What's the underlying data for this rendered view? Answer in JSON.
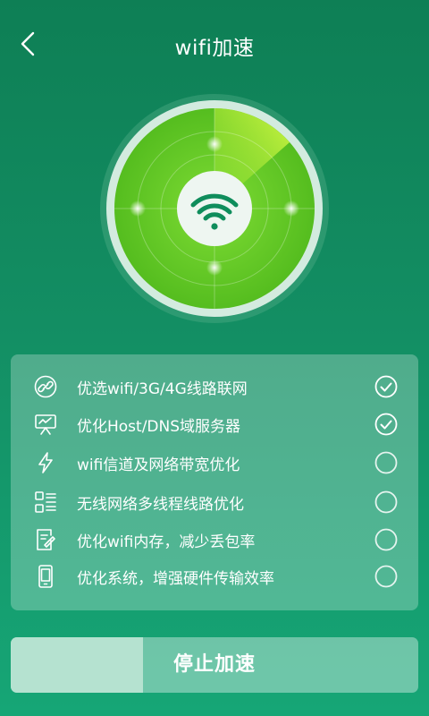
{
  "header": {
    "title": "wifi加速",
    "back_icon": "chevron-left-icon"
  },
  "radar": {
    "center_icon": "wifi-icon",
    "colors": {
      "ring": "#cfe9dc",
      "disc": "#6ccf2a",
      "disc_edge": "#4db51c",
      "sweep": "#c8f53a",
      "center": "#eef6f1",
      "wifi": "#0f8d5c"
    }
  },
  "tasks": [
    {
      "label": "优选wifi/3G/4G线路联网",
      "icon": "link-icon",
      "done": true
    },
    {
      "label": "优化Host/DNS域服务器",
      "icon": "server-icon",
      "done": true
    },
    {
      "label": "wifi信道及网络带宽优化",
      "icon": "lightning-icon",
      "done": false
    },
    {
      "label": "无线网络多线程线路优化",
      "icon": "list-icon",
      "done": false
    },
    {
      "label": "优化wifi内存，减少丢包率",
      "icon": "document-icon",
      "done": false
    },
    {
      "label": "优化系统，增强硬件传输效率",
      "icon": "phone-icon",
      "done": false
    }
  ],
  "action": {
    "label": "停止加速",
    "progress": 0.325
  }
}
